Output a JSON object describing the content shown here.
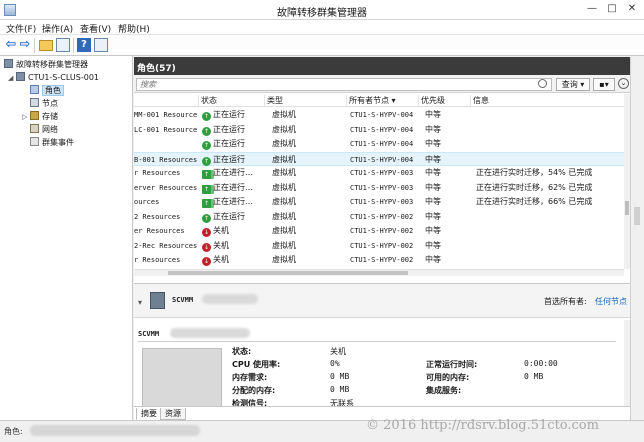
{
  "window": {
    "title": "故障转移群集管理器",
    "minimize": "—",
    "maximize": "□",
    "close": "✕"
  },
  "menu": [
    "文件(F)",
    "操作(A)",
    "查看(V)",
    "帮助(H)"
  ],
  "tree": {
    "root": "故障转移群集管理器",
    "cluster": "CTU1-S-CLUS-001",
    "items": [
      {
        "label": "角色",
        "icon": "roles-icon",
        "selected": true
      },
      {
        "label": "节点",
        "icon": "nodes-icon"
      },
      {
        "label": "存储",
        "icon": "storage-icon",
        "expandable": true
      },
      {
        "label": "网络",
        "icon": "network-icon"
      },
      {
        "label": "群集事件",
        "icon": "events-icon"
      }
    ]
  },
  "roles": {
    "header": "角色(57)",
    "search_placeholder": "搜索",
    "query_button": "查询",
    "save_button": "▾",
    "columns": [
      "状态",
      "类型",
      "所有者节点",
      "优先级",
      "信息"
    ],
    "rows": [
      {
        "name": "MM-001 Resources",
        "status": "正在运行",
        "state": "running",
        "type": "虚拟机",
        "owner": "CTU1-S-HYPV-004",
        "priority": "中等",
        "info": ""
      },
      {
        "name": "LC-001 Resources",
        "status": "正在运行",
        "state": "running",
        "type": "虚拟机",
        "owner": "CTU1-S-HYPV-004",
        "priority": "中等",
        "info": ""
      },
      {
        "name": "",
        "status": "正在运行",
        "state": "running",
        "type": "虚拟机",
        "owner": "CTU1-S-HYPV-004",
        "priority": "中等",
        "info": ""
      },
      {
        "name": "B-001 Resources",
        "status": "正在运行",
        "state": "running",
        "type": "虚拟机",
        "owner": "CTU1-S-HYPV-004",
        "priority": "中等",
        "info": "",
        "selected": true
      },
      {
        "name": "r Resources",
        "status": "正在进行…",
        "state": "migrating",
        "type": "虚拟机",
        "owner": "CTU1-S-HYPV-003",
        "priority": "中等",
        "info": "正在进行实时迁移，54% 已完成"
      },
      {
        "name": "erver Resources",
        "status": "正在进行…",
        "state": "migrating",
        "type": "虚拟机",
        "owner": "CTU1-S-HYPV-003",
        "priority": "中等",
        "info": "正在进行实时迁移，62% 已完成"
      },
      {
        "name": "ources",
        "status": "正在进行…",
        "state": "migrating",
        "type": "虚拟机",
        "owner": "CTU1-S-HYPV-003",
        "priority": "中等",
        "info": "正在进行实时迁移，66% 已完成"
      },
      {
        "name": "2 Resources",
        "status": "正在运行",
        "state": "running",
        "type": "虚拟机",
        "owner": "CTU1-S-HYPV-002",
        "priority": "中等",
        "info": ""
      },
      {
        "name": "er Resources",
        "status": "关机",
        "state": "off",
        "type": "虚拟机",
        "owner": "CTU1-S-HYPV-002",
        "priority": "中等",
        "info": ""
      },
      {
        "name": "2-Rec Resources",
        "status": "关机",
        "state": "off",
        "type": "虚拟机",
        "owner": "CTU1-S-HYPV-002",
        "priority": "中等",
        "info": ""
      },
      {
        "name": "r Resources",
        "status": "关机",
        "state": "off",
        "type": "虚拟机",
        "owner": "CTU1-S-HYPV-002",
        "priority": "中等",
        "info": ""
      }
    ]
  },
  "detail": {
    "vm_name": "SCVMM",
    "title": "SCVMM",
    "preferred_owners_label": "首选所有者:",
    "any_node_link": "任何节点",
    "fields": [
      {
        "label": "状态:",
        "value": "关机"
      },
      {
        "label": "CPU 使用率:",
        "value": "0%"
      },
      {
        "label": "内存需求:",
        "value": "0 MB"
      },
      {
        "label": "分配的内存:",
        "value": "0 MB"
      },
      {
        "label": "检测信号:",
        "value": "无联系"
      }
    ],
    "fields_right": [
      {
        "label": "正常运行时间:",
        "value": "0:00:00"
      },
      {
        "label": "可用的内存:",
        "value": "0 MB"
      },
      {
        "label": "集成服务:",
        "value": ""
      }
    ],
    "tabs": [
      "摘要",
      "资源"
    ]
  },
  "statusbar": {
    "text": "角色:"
  },
  "watermark": "© 2016 http://rdsrv.blog.51cto.com"
}
